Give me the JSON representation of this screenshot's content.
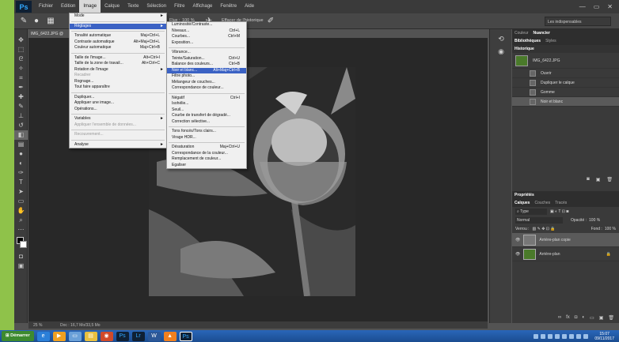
{
  "app": {
    "logo": "Ps",
    "title_doc": "IMG_6422.JPG @"
  },
  "menubar": {
    "items": [
      "Fichier",
      "Edition",
      "Image",
      "Calque",
      "Texte",
      "Sélection",
      "Filtre",
      "Affichage",
      "Fenêtre",
      "Aide"
    ],
    "active": "Image",
    "window_controls": [
      "—",
      "▭",
      "✕"
    ]
  },
  "options_bar": {
    "zoom_label": "Flux :",
    "zoom_value": "100 %",
    "history_effect": "Effacer de l'historique",
    "workspace": "Les indispensables"
  },
  "image_menu": [
    {
      "label": "Mode",
      "shortcut": "",
      "arrow": "►",
      "type": "item"
    },
    {
      "type": "sep"
    },
    {
      "label": "Réglages",
      "shortcut": "",
      "arrow": "►",
      "type": "item",
      "highlight": true
    },
    {
      "type": "sep"
    },
    {
      "label": "Tonalité automatique",
      "shortcut": "Maj+Ctrl+L",
      "type": "item"
    },
    {
      "label": "Contraste automatique",
      "shortcut": "Alt+Maj+Ctrl+L",
      "type": "item"
    },
    {
      "label": "Couleur automatique",
      "shortcut": "Maj+Ctrl+B",
      "type": "item"
    },
    {
      "type": "sep"
    },
    {
      "label": "Taille de l'image...",
      "shortcut": "Alt+Ctrl+I",
      "type": "item"
    },
    {
      "label": "Taille de la zone de travail...",
      "shortcut": "Alt+Ctrl+C",
      "type": "item"
    },
    {
      "label": "Rotation de l'image",
      "shortcut": "",
      "arrow": "►",
      "type": "item"
    },
    {
      "label": "Recadrer",
      "shortcut": "",
      "type": "item",
      "disabled": true
    },
    {
      "label": "Rognage...",
      "shortcut": "",
      "type": "item"
    },
    {
      "label": "Tout faire apparaître",
      "shortcut": "",
      "type": "item"
    },
    {
      "type": "sep"
    },
    {
      "label": "Dupliquer...",
      "shortcut": "",
      "type": "item"
    },
    {
      "label": "Appliquer une image...",
      "shortcut": "",
      "type": "item"
    },
    {
      "label": "Opérations...",
      "shortcut": "",
      "type": "item"
    },
    {
      "type": "sep"
    },
    {
      "label": "Variables",
      "shortcut": "",
      "arrow": "►",
      "type": "item"
    },
    {
      "label": "Appliquer l'ensemble de données...",
      "shortcut": "",
      "type": "item",
      "disabled": true
    },
    {
      "type": "sep"
    },
    {
      "label": "Recouvrement...",
      "shortcut": "",
      "type": "item",
      "disabled": true
    },
    {
      "type": "sep"
    },
    {
      "label": "Analyse",
      "shortcut": "",
      "arrow": "►",
      "type": "item"
    }
  ],
  "adjust_menu": [
    {
      "label": "Luminosité/Contraste...",
      "shortcut": "",
      "type": "item"
    },
    {
      "label": "Niveaux...",
      "shortcut": "Ctrl+L",
      "type": "item"
    },
    {
      "label": "Courbes...",
      "shortcut": "Ctrl+M",
      "type": "item"
    },
    {
      "label": "Exposition...",
      "shortcut": "",
      "type": "item"
    },
    {
      "type": "sep"
    },
    {
      "label": "Vibrance...",
      "shortcut": "",
      "type": "item"
    },
    {
      "label": "Teinte/Saturation...",
      "shortcut": "Ctrl+U",
      "type": "item"
    },
    {
      "label": "Balance des couleurs...",
      "shortcut": "Ctrl+B",
      "type": "item"
    },
    {
      "label": "Noir et blanc...",
      "shortcut": "Alt+Maj+Ctrl+B",
      "type": "item",
      "highlight": true
    },
    {
      "label": "Filtre photo...",
      "shortcut": "",
      "type": "item"
    },
    {
      "label": "Mélangeur de couches...",
      "shortcut": "",
      "type": "item"
    },
    {
      "label": "Correspondance de couleur...",
      "shortcut": "",
      "type": "item"
    },
    {
      "type": "sep"
    },
    {
      "label": "Négatif",
      "shortcut": "Ctrl+I",
      "type": "item"
    },
    {
      "label": "Isohélie...",
      "shortcut": "",
      "type": "item"
    },
    {
      "label": "Seuil...",
      "shortcut": "",
      "type": "item"
    },
    {
      "label": "Courbe de transfert de dégradé...",
      "shortcut": "",
      "type": "item"
    },
    {
      "label": "Correction sélective...",
      "shortcut": "",
      "type": "item"
    },
    {
      "type": "sep"
    },
    {
      "label": "Tons foncés/Tons clairs...",
      "shortcut": "",
      "type": "item"
    },
    {
      "label": "Virage HDR...",
      "shortcut": "",
      "type": "item"
    },
    {
      "type": "sep"
    },
    {
      "label": "Désaturation",
      "shortcut": "Maj+Ctrl+U",
      "type": "item"
    },
    {
      "label": "Correspondance de la couleur...",
      "shortcut": "",
      "type": "item"
    },
    {
      "label": "Remplacement de couleur...",
      "shortcut": "",
      "type": "item"
    },
    {
      "label": "Egaliser",
      "shortcut": "",
      "type": "item"
    }
  ],
  "history_panel": {
    "tabs": [
      "Couleur",
      "Nuancier"
    ],
    "tabs2": [
      "Bibliothèques",
      "Styles"
    ],
    "title": "Historique",
    "snapshot": "IMG_6422.JPG",
    "rows": [
      "Ouvrir",
      "Dupliquer le calque",
      "Gomme",
      "Noir et blanc"
    ]
  },
  "layers_panel": {
    "title": "Propriétés",
    "tabs": [
      "Calques",
      "Couches",
      "Tracés"
    ],
    "filter": "Type",
    "blend_mode": "Normal",
    "opacity_label": "Opacité :",
    "opacity_value": "100 %",
    "lock_label": "Verrou :",
    "fill_label": "Fond :",
    "fill_value": "100 %",
    "layers": [
      "Arrière-plan copie",
      "Arrière-plan"
    ]
  },
  "statusbar": {
    "zoom": "25 %",
    "doc": "Doc : 16,7 Mo/33,5 Mo"
  },
  "taskbar": {
    "start": "Démarrer",
    "time": "15:07",
    "date": "09/11/2017"
  },
  "colors": {
    "accent": "#3b62c4",
    "ps_blue": "#31a8ff",
    "desktop": "#8fc24a"
  }
}
